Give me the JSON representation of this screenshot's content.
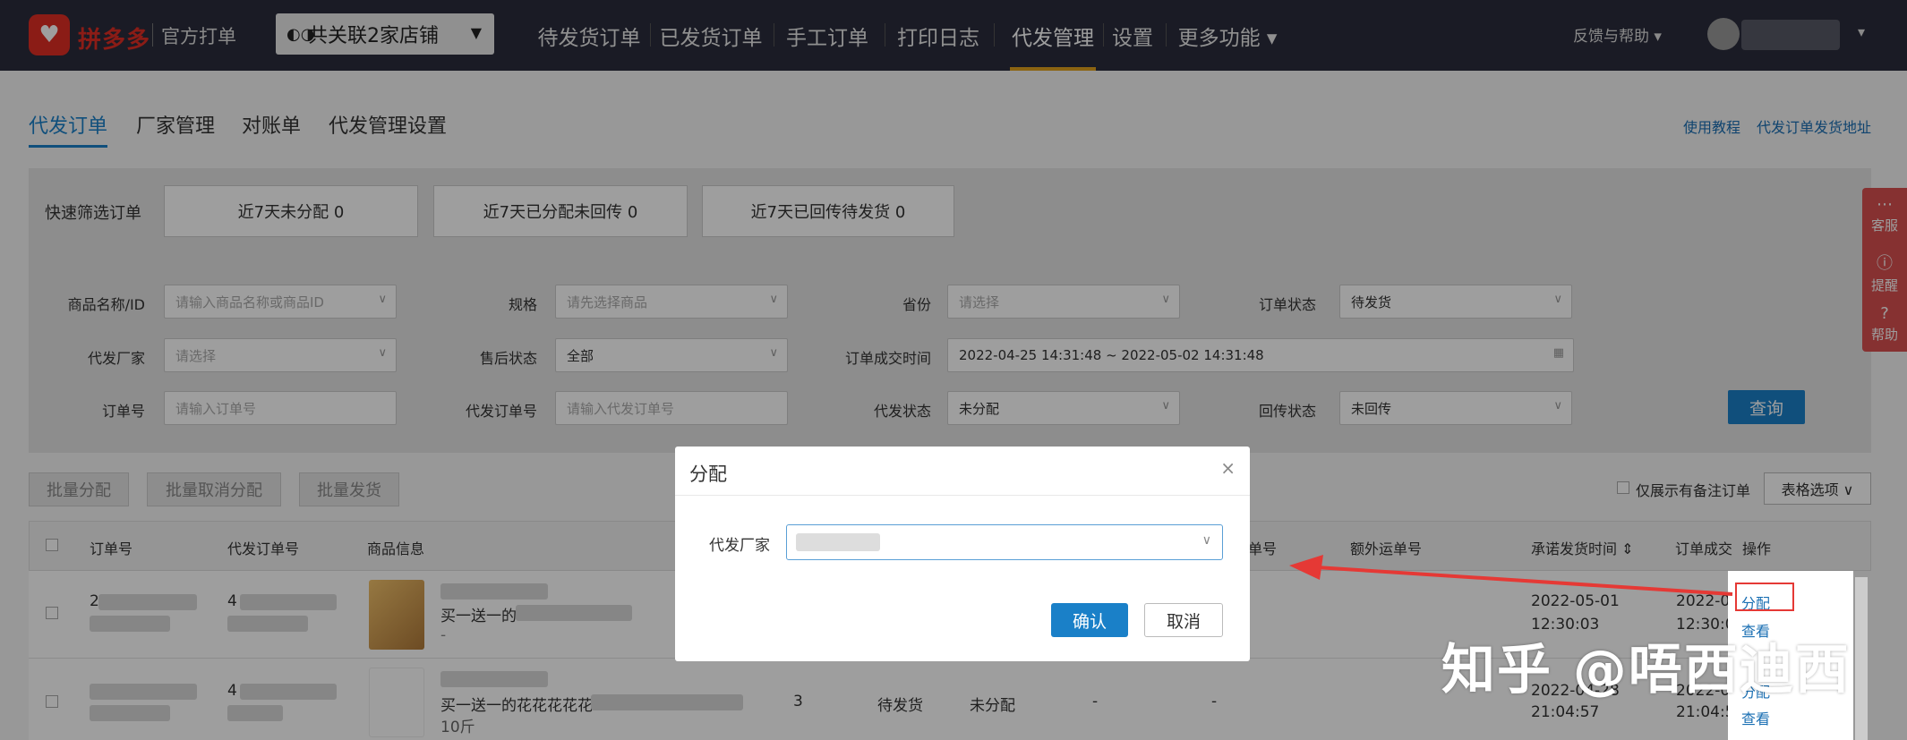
{
  "header": {
    "brand": "拼多多",
    "brand_sub": "官方打单",
    "shop_selector": "共关联2家店铺",
    "nav": [
      {
        "label": "待发货订单"
      },
      {
        "label": "已发货订单"
      },
      {
        "label": "手工订单"
      },
      {
        "label": "打印日志"
      },
      {
        "label": "代发管理",
        "active": true
      },
      {
        "label": "设置"
      },
      {
        "label": "更多功能 ▾"
      }
    ],
    "feedback": "反馈与帮助 ▾",
    "user_caret": "▾"
  },
  "subtabs": [
    "代发订单",
    "厂家管理",
    "对账单",
    "代发管理设置"
  ],
  "toplinks": [
    "使用教程",
    "代发订单发货地址"
  ],
  "quick_filter": {
    "label": "快速筛选订单",
    "buttons": [
      "近7天未分配  0",
      "近7天已分配未回传  0",
      "近7天已回传待发货  0"
    ]
  },
  "filters": {
    "product_label": "商品名称/ID",
    "product_placeholder": "请输入商品名称或商品ID",
    "spec_label": "规格",
    "spec_placeholder": "请先选择商品",
    "province_label": "省份",
    "province_placeholder": "请选择",
    "order_status_label": "订单状态",
    "order_status_value": "待发货",
    "factory_label": "代发厂家",
    "factory_placeholder": "请选择",
    "aftersale_label": "售后状态",
    "aftersale_value": "全部",
    "deal_time_label": "订单成交时间",
    "deal_time_value": "2022-04-25 14:31:48 ~ 2022-05-02 14:31:48",
    "order_no_label": "订单号",
    "order_no_placeholder": "请输入订单号",
    "dropship_no_label": "代发订单号",
    "dropship_no_placeholder": "请输入代发订单号",
    "dropship_status_label": "代发状态",
    "dropship_status_value": "未分配",
    "return_status_label": "回传状态",
    "return_status_value": "未回传",
    "search_button": "查询"
  },
  "actions": {
    "batch_assign": "批量分配",
    "batch_unassign": "批量取消分配",
    "batch_ship": "批量发货",
    "note_only": "仅展示有备注订单",
    "table_options": "表格选项 ∨"
  },
  "table": {
    "headers": [
      "订单号",
      "代发订单号",
      "商品信息",
      "单号",
      "额外运单号",
      "承诺发货时间 ⇕",
      "订单成交",
      "操作"
    ],
    "rows": [
      {
        "order_no": "2",
        "dropship_no": "4",
        "product_title": "买一送一的",
        "product_extra": "-",
        "promise_time_date": "2022-05-01",
        "promise_time_clock": "12:30:03",
        "deal_date": "2022-0",
        "deal_clock": "12:30:0",
        "op_assign": "分配",
        "op_view": "查看"
      },
      {
        "order_no": "",
        "dropship_no": "4",
        "product_title": "买一送一的花花花花花",
        "product_extra": "10斤",
        "qty": "3",
        "status": "待发货",
        "assign_status": "未分配",
        "dash1": "-",
        "dash2": "-",
        "promise_time_date": "2022-04-28",
        "promise_time_clock": "21:04:57",
        "deal_date": "2022-0",
        "deal_clock": "21:04:5",
        "op_assign": "分配",
        "op_view": "查看"
      }
    ]
  },
  "side_tools": [
    "客服",
    "提醒",
    "帮助"
  ],
  "dialog": {
    "title": "分配",
    "close": "×",
    "field_label": "代发厂家",
    "ok": "确认",
    "cancel": "取消"
  },
  "watermark": "知乎 @唔西迪西",
  "colors": {
    "primary": "#1a80c8",
    "topbar": "#2b2d3c",
    "brand": "#e02e24",
    "nav_active_underline": "#e0a21e",
    "highlight": "#e53935"
  }
}
